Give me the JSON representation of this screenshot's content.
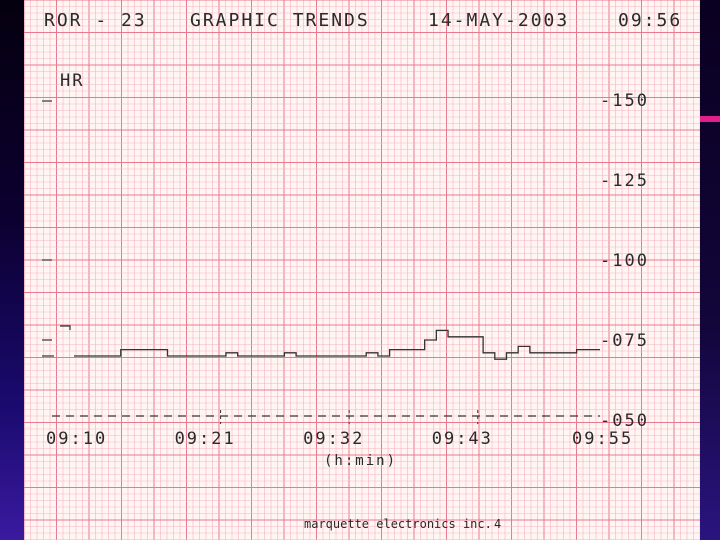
{
  "header": {
    "room": "ROR - 23",
    "title": "GRAPHIC TRENDS",
    "date": "14-MAY-2003",
    "time": "09:56"
  },
  "footer": {
    "manufacturer": "marquette electronics inc.",
    "page": "4"
  },
  "colors": {
    "grid_major": "#e8798f",
    "grid_minor": "#f4b3bf",
    "trace": "#333333",
    "paper": "#fff6f3",
    "accent": "#e0208a"
  },
  "chart_data": {
    "type": "line",
    "title": "GRAPHIC TRENDS",
    "series": [
      {
        "name": "HR",
        "points": [
          [
            "09:10",
            70
          ],
          [
            "09:13",
            70
          ],
          [
            "09:14",
            72
          ],
          [
            "09:17",
            72
          ],
          [
            "09:18",
            70
          ],
          [
            "09:22",
            70
          ],
          [
            "09:23",
            71
          ],
          [
            "09:24",
            70
          ],
          [
            "09:27",
            70
          ],
          [
            "09:28",
            71
          ],
          [
            "09:29",
            70
          ],
          [
            "09:34",
            70
          ],
          [
            "09:35",
            71
          ],
          [
            "09:36",
            70
          ],
          [
            "09:37",
            72
          ],
          [
            "09:39",
            72
          ],
          [
            "09:40",
            75
          ],
          [
            "09:41",
            78
          ],
          [
            "09:42",
            76
          ],
          [
            "09:44",
            76
          ],
          [
            "09:45",
            71
          ],
          [
            "09:46",
            69
          ],
          [
            "09:47",
            71
          ],
          [
            "09:48",
            73
          ],
          [
            "09:49",
            71
          ],
          [
            "09:52",
            71
          ],
          [
            "09:53",
            72
          ],
          [
            "09:55",
            72
          ]
        ]
      }
    ],
    "x": {
      "label": "(h:min)",
      "ticks": [
        "09:10",
        "09:21",
        "09:32",
        "09:43",
        "09:55"
      ],
      "range": [
        "09:10",
        "09:55"
      ]
    },
    "y": {
      "label": "HR",
      "ticks": [
        "-150",
        "-125",
        "-100",
        "-075",
        "-050"
      ],
      "range": [
        50,
        150
      ]
    },
    "grid": true
  }
}
